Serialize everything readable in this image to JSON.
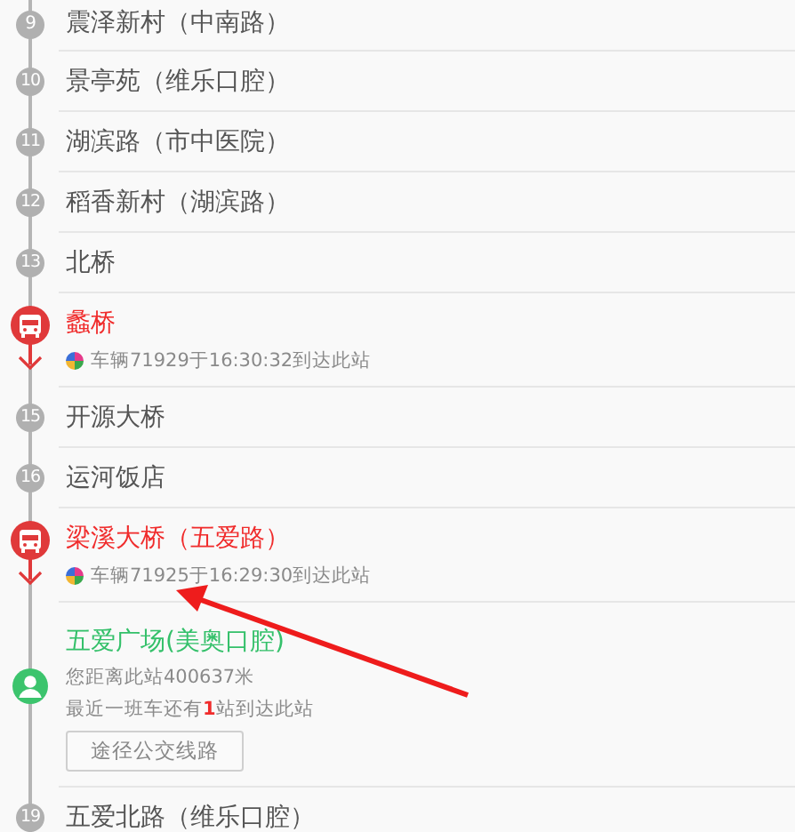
{
  "stops": [
    {
      "kind": "stop",
      "number": "9",
      "name": "震泽新村（中南路）"
    },
    {
      "kind": "stop",
      "number": "10",
      "name": "景亭苑（维乐口腔）"
    },
    {
      "kind": "stop",
      "number": "11",
      "name": "湖滨路（市中医院）"
    },
    {
      "kind": "stop",
      "number": "12",
      "name": "稻香新村（湖滨路）"
    },
    {
      "kind": "stop",
      "number": "13",
      "name": "北桥"
    },
    {
      "kind": "bus",
      "name": "蠡桥",
      "arrival": "车辆71929于16:30:32到达此站"
    },
    {
      "kind": "stop",
      "number": "15",
      "name": "开源大桥"
    },
    {
      "kind": "stop",
      "number": "16",
      "name": "运河饭店"
    },
    {
      "kind": "bus",
      "name": "梁溪大桥（五爱路）",
      "arrival": "车辆71925于16:29:30到达此站"
    },
    {
      "kind": "mine",
      "name": "五爱广场(美奥口腔)",
      "distance": "您距离此站400637米",
      "next_bus": "最近一班车还有**1**站到达此站",
      "button": "途径公交线路"
    },
    {
      "kind": "stop",
      "number": "19",
      "name": "五爱北路（维乐口腔）"
    }
  ]
}
